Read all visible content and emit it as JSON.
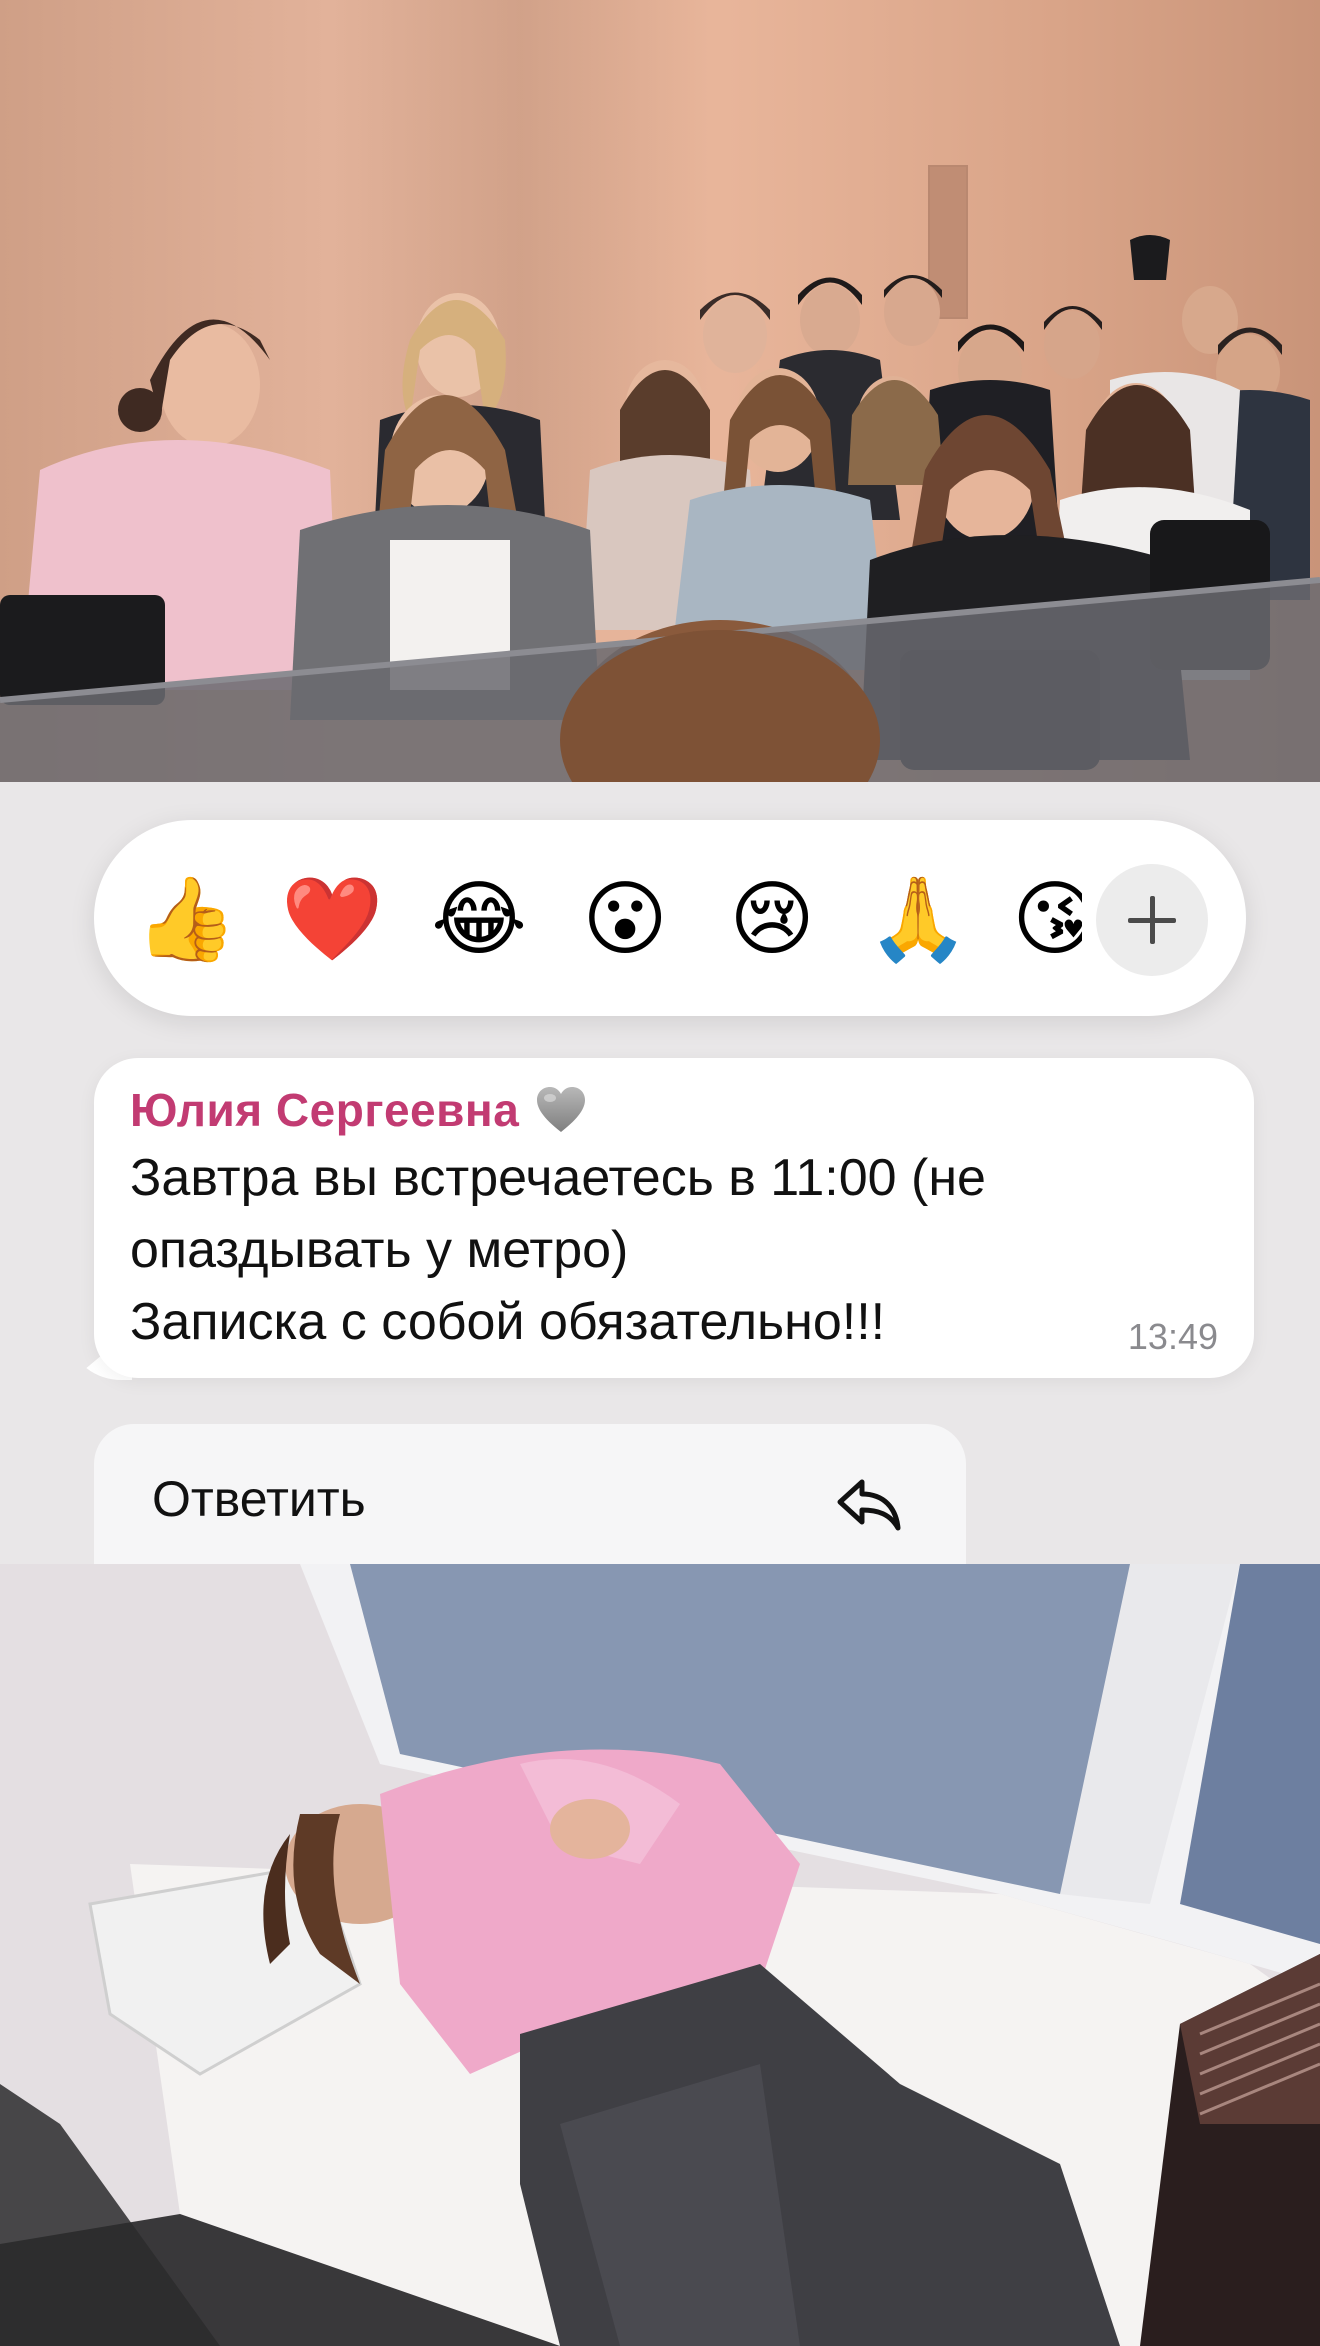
{
  "photos": {
    "top": "classroom-photo",
    "bottom": "window-sill-photo"
  },
  "reactions": {
    "items": [
      {
        "name": "thumbs-up",
        "glyph": "👍"
      },
      {
        "name": "heart",
        "glyph": "❤️"
      },
      {
        "name": "tears-of-joy",
        "glyph": "😂"
      },
      {
        "name": "surprised",
        "glyph": "😮"
      },
      {
        "name": "crying",
        "glyph": "😢"
      },
      {
        "name": "folded-hands",
        "glyph": "🙏"
      },
      {
        "name": "heart-kiss",
        "glyph": "😘"
      }
    ],
    "more_icon": "plus-icon"
  },
  "message": {
    "sender": "Юлия Сергеевна",
    "sender_color": "#c23b72",
    "sender_badge_icon": "grey-heart-icon",
    "lines": [
      "Завтра вы встречаетесь в 11:00 (не",
      "опаздывать у метро)",
      "Записка с собой обязательно!!!"
    ],
    "time": "13:49"
  },
  "menu": {
    "reply_label": "Ответить",
    "reply_icon": "reply-arrow-icon"
  }
}
